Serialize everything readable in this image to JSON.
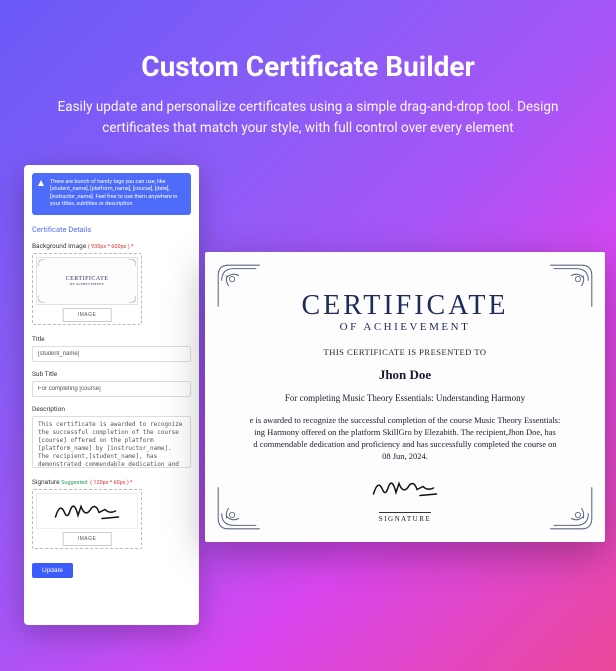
{
  "hero": {
    "title": "Custom Certificate Builder",
    "subtitle": "Easily update and personalize certificates using a simple drag-and-drop tool. Design certificates that match your style, with full control over every element"
  },
  "panel": {
    "alert": "There are bunch of handy tags you can use, like [student_name], [platform_name], [course], [date], [instructor_name]. Feel free to use them anywhere in your titles, subtitles or description",
    "section_title": "Certificate Details",
    "bg_label": "Background Image",
    "bg_hint": "( 930px * 600px ) *",
    "title_label": "Title",
    "title_value": "[student_name]",
    "subtitle_label": "Sub Title",
    "subtitle_value": "For completing [course]",
    "desc_label": "Description",
    "desc_value": "This certificate is awarded to recognize the successful completion of the course [course] offered on the platform [platform_name] by [instructor_name]. The recipient,[student_name], has demonstrated commendable dedication and proficiency and has successfully completed the course on [date].",
    "sig_label": "Signature",
    "sig_suggest": "Suggested:",
    "sig_hint": "( 120px * 60px ) *",
    "image_btn": "IMAGE",
    "update_btn": "Update",
    "mini_cert_title": "CERTIFICATE",
    "mini_cert_sub": "OF ACHIEVEMENT"
  },
  "cert": {
    "title": "CERTIFICATE",
    "subtitle": "OF ACHIEVEMENT",
    "presented": "THIS CERTIFICATE IS PRESENTED TO",
    "name": "Jhon Doe",
    "for_line": "For completing Music Theory Essentials: Understanding Harmony",
    "body1": "e is awarded to recognize the successful completion of the course Music Theory Essentials:",
    "body2": "ing Harmony offered on the platform SkillGro by Elezabith. The recipient,Jhon Doe, has",
    "body3": "d commendable dedication and proficiency and has successfully completed the course on",
    "body4": "08 Jun, 2024.",
    "sig_label": "SIGNATURE"
  }
}
